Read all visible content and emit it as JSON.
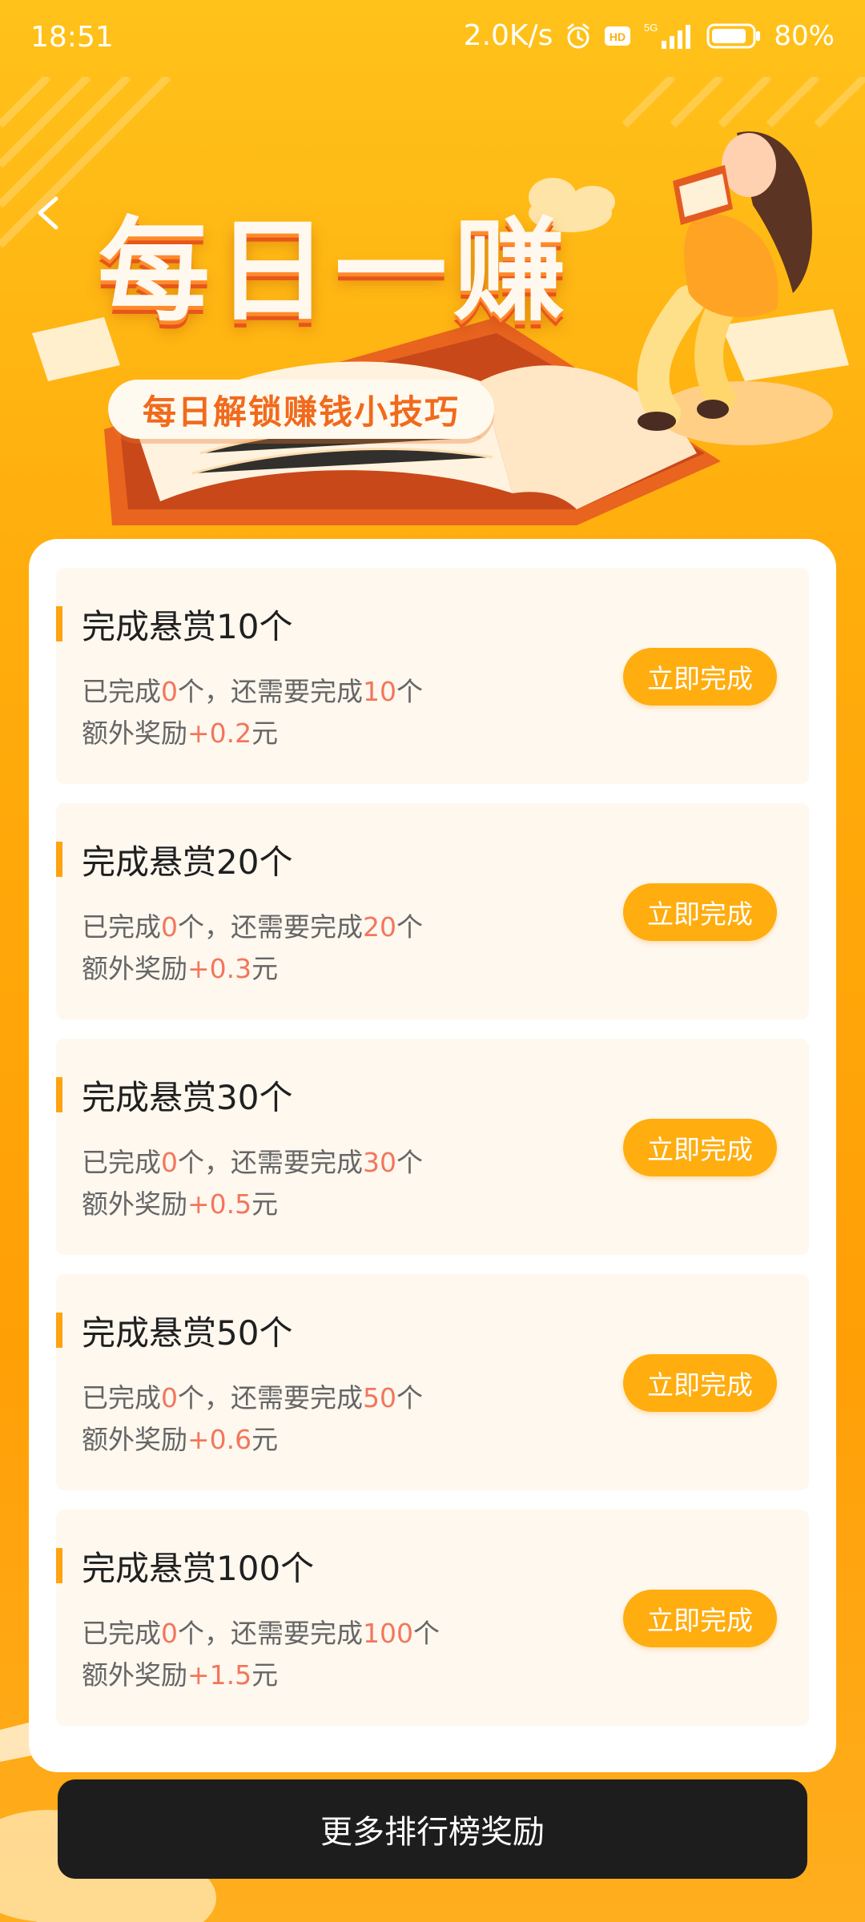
{
  "status_bar": {
    "time": "18:51",
    "net_speed": "2.0K/s",
    "network": "5G",
    "battery": "80%"
  },
  "hero": {
    "title": "每日一赚",
    "subtitle": "每日解锁赚钱小技巧",
    "back_icon": "chevron-left-icon"
  },
  "tasks": [
    {
      "title": "完成悬赏10个",
      "done_prefix": "已完成",
      "done_count": "0",
      "done_mid": "个，还需要完成",
      "remaining": "10",
      "done_suffix": "个",
      "reward_prefix": "额外奖励",
      "reward": "+0.2",
      "reward_unit": "元",
      "button": "立即完成"
    },
    {
      "title": "完成悬赏20个",
      "done_prefix": "已完成",
      "done_count": "0",
      "done_mid": "个，还需要完成",
      "remaining": "20",
      "done_suffix": "个",
      "reward_prefix": "额外奖励",
      "reward": "+0.3",
      "reward_unit": "元",
      "button": "立即完成"
    },
    {
      "title": "完成悬赏30个",
      "done_prefix": "已完成",
      "done_count": "0",
      "done_mid": "个，还需要完成",
      "remaining": "30",
      "done_suffix": "个",
      "reward_prefix": "额外奖励",
      "reward": "+0.5",
      "reward_unit": "元",
      "button": "立即完成"
    },
    {
      "title": "完成悬赏50个",
      "done_prefix": "已完成",
      "done_count": "0",
      "done_mid": "个，还需要完成",
      "remaining": "50",
      "done_suffix": "个",
      "reward_prefix": "额外奖励",
      "reward": "+0.6",
      "reward_unit": "元",
      "button": "立即完成"
    },
    {
      "title": "完成悬赏100个",
      "done_prefix": "已完成",
      "done_count": "0",
      "done_mid": "个，还需要完成",
      "remaining": "100",
      "done_suffix": "个",
      "reward_prefix": "额外奖励",
      "reward": "+1.5",
      "reward_unit": "元",
      "button": "立即完成"
    }
  ],
  "footer": {
    "button_label": "更多排行榜奖励"
  },
  "colors": {
    "accent_orange": "#ffad0f",
    "highlight_red": "#f3765c",
    "dark_button": "#1d1d1d",
    "card_bg": "#fef8ef"
  }
}
